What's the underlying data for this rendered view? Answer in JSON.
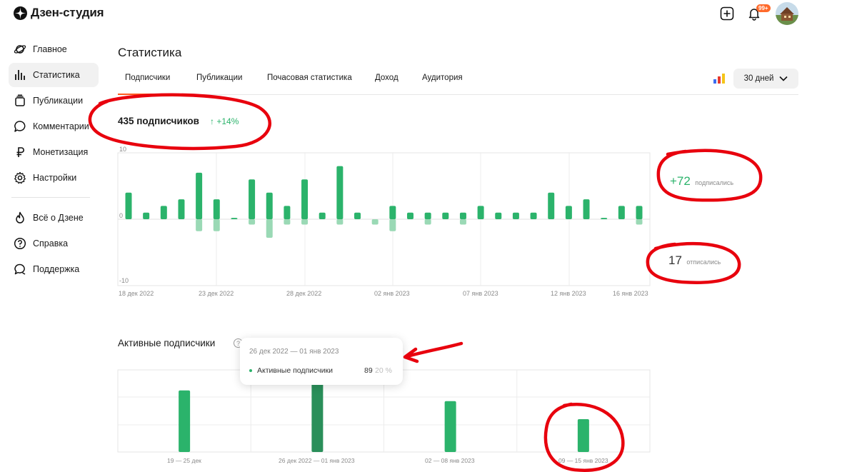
{
  "header": {
    "logo_text": "Дзен-студия",
    "notification_badge": "99+",
    "icons": [
      "dzen-logo-icon",
      "add-icon",
      "bell-icon",
      "avatar"
    ]
  },
  "sidebar": {
    "items": [
      {
        "label": "Главное",
        "icon": "planet-icon",
        "active": false
      },
      {
        "label": "Статистика",
        "icon": "bar-chart-icon",
        "active": true
      },
      {
        "label": "Публикации",
        "icon": "stack-icon",
        "active": false
      },
      {
        "label": "Комментарии",
        "icon": "comment-icon",
        "active": false
      },
      {
        "label": "Монетизация",
        "icon": "ruble-icon",
        "active": false
      },
      {
        "label": "Настройки",
        "icon": "gear-icon",
        "active": false
      },
      {
        "label": "Всё о Дзене",
        "icon": "flame-icon",
        "active": false
      },
      {
        "label": "Справка",
        "icon": "help-icon",
        "active": false
      },
      {
        "label": "Поддержка",
        "icon": "support-icon",
        "active": false
      }
    ]
  },
  "page": {
    "title": "Статистика",
    "tabs": [
      "Подписчики",
      "Публикации",
      "Почасовая статистика",
      "Доход",
      "Аудитория"
    ],
    "active_tab": "Подписчики",
    "period": "30 дней"
  },
  "subscribers": {
    "count_text": "435 подписчиков",
    "growth_text": "↑ +14%",
    "subscribed_value": "+72",
    "subscribed_label": "подписались",
    "unsubscribed_value": "17",
    "unsubscribed_label": "отписались"
  },
  "active": {
    "title": "Активные подписчики",
    "tooltip": {
      "range": "26 дек 2022 — 01 янв 2023",
      "label": "Активные подписчики",
      "value": "89",
      "percent": "20 %"
    }
  },
  "colors": {
    "green": "#2bb36b",
    "green_light": "#9ad9b5",
    "green_dark": "#2a8f5a",
    "accent": "#ff5a1f",
    "annotation": "#e8000d"
  },
  "chart_data": [
    {
      "type": "bar",
      "ylim": [
        -10,
        10
      ],
      "y_ticks": [
        "10",
        "0",
        "-10"
      ],
      "x_tick_labels": [
        "18 дек 2022",
        "23 дек 2022",
        "28 дек 2022",
        "02 янв 2023",
        "07 янв 2023",
        "12 янв 2023",
        "16 янв 2023"
      ],
      "series": [
        {
          "values": [
            4,
            1,
            2,
            3,
            7,
            3,
            0.2,
            6,
            4,
            2,
            6,
            1,
            8,
            1,
            0,
            2,
            1,
            1,
            1,
            1,
            2,
            1,
            1,
            1,
            4,
            2,
            3,
            0.2,
            2,
            2
          ]
        },
        {
          "values": [
            0,
            0,
            0,
            0,
            -1.8,
            -1.8,
            0,
            -0.8,
            -2.8,
            -0.8,
            -0.8,
            0,
            -0.8,
            0,
            -0.8,
            -1.8,
            0,
            -0.8,
            0,
            -0.8,
            0,
            0,
            0,
            0,
            0,
            0,
            0,
            0,
            0,
            -0.8
          ]
        }
      ]
    },
    {
      "type": "bar",
      "title": "Активные подписчики",
      "categories": [
        "19 — 25 дек",
        "26 дек 2022 — 01 янв 2023",
        "02 — 08 янв 2023",
        "09 — 15 янв 2023"
      ],
      "values": [
        75,
        85,
        62,
        40
      ],
      "highlighted_index": 1
    }
  ]
}
